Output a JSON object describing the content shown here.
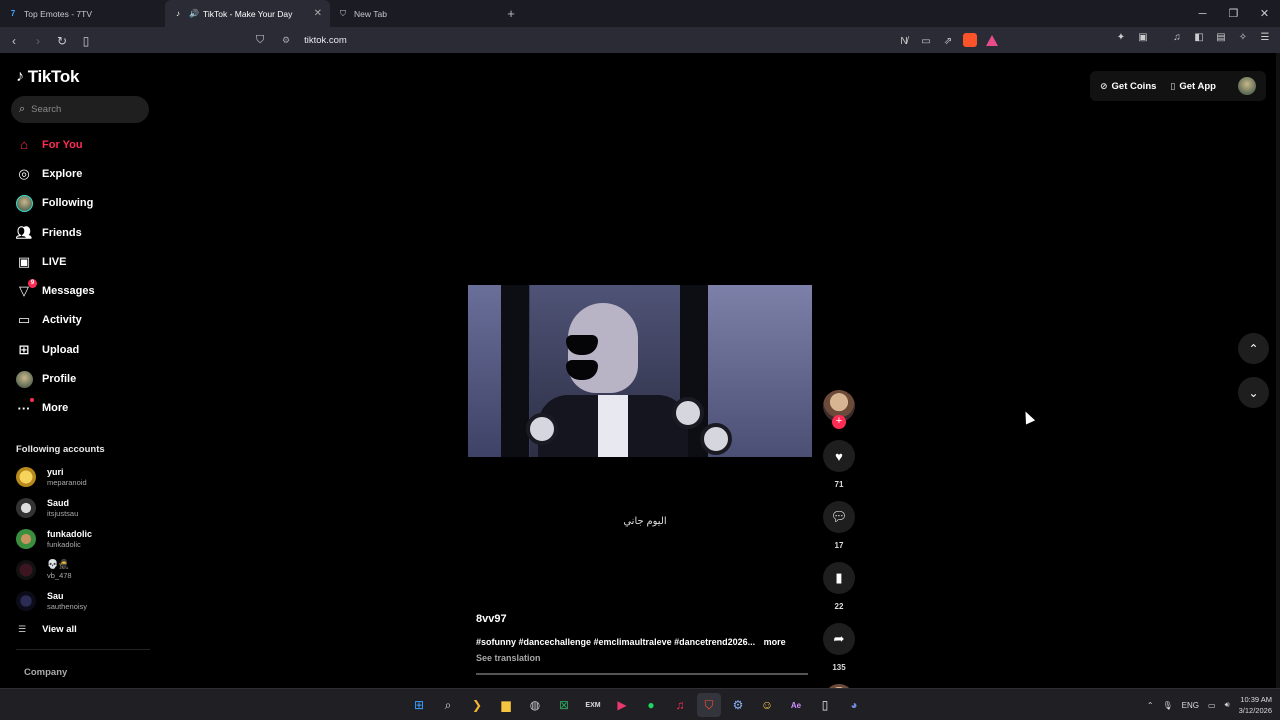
{
  "browser": {
    "tabs": [
      {
        "title": "Top Emotes - 7TV",
        "active": false
      },
      {
        "title": "TikTok - Make Your Day",
        "active": true
      },
      {
        "title": "New Tab",
        "active": false
      }
    ],
    "url": "tiktok.com"
  },
  "sidebar": {
    "logo": "TikTok",
    "search_placeholder": "Search",
    "nav": [
      {
        "label": "For You",
        "icon": "home-icon",
        "active": true
      },
      {
        "label": "Explore",
        "icon": "compass-icon"
      },
      {
        "label": "Following",
        "icon": "following-avatar"
      },
      {
        "label": "Friends",
        "icon": "friends-icon"
      },
      {
        "label": "LIVE",
        "icon": "live-icon"
      },
      {
        "label": "Messages",
        "icon": "messages-icon",
        "badge": "9"
      },
      {
        "label": "Activity",
        "icon": "activity-icon"
      },
      {
        "label": "Upload",
        "icon": "upload-icon"
      },
      {
        "label": "Profile",
        "icon": "profile-avatar"
      },
      {
        "label": "More",
        "icon": "more-icon"
      }
    ],
    "following_title": "Following accounts",
    "following": [
      {
        "name": "yuri",
        "handle": "meparanoid"
      },
      {
        "name": "Saud",
        "handle": "itsjustsau"
      },
      {
        "name": "funkadolic",
        "handle": "funkadolic"
      },
      {
        "name": "💀🥷",
        "handle": "vb_478"
      },
      {
        "name": "Sau",
        "handle": "sauthenoisy"
      }
    ],
    "view_all": "View all",
    "company": "Company"
  },
  "header": {
    "get_coins": "Get Coins",
    "get_app": "Get App"
  },
  "video": {
    "caption_overlay": "اليوم جاني",
    "author": "8vv97",
    "hashtags": "#sofunny #dancechallenge #emclimaultraleve #dancetrend2026...",
    "more": "more",
    "see_translation": "See translation",
    "likes": "71",
    "comments": "17",
    "saves": "22",
    "shares": "135"
  },
  "taskbar": {
    "lang": "ENG",
    "time": "10:39 AM",
    "date": "3/12/2026"
  }
}
